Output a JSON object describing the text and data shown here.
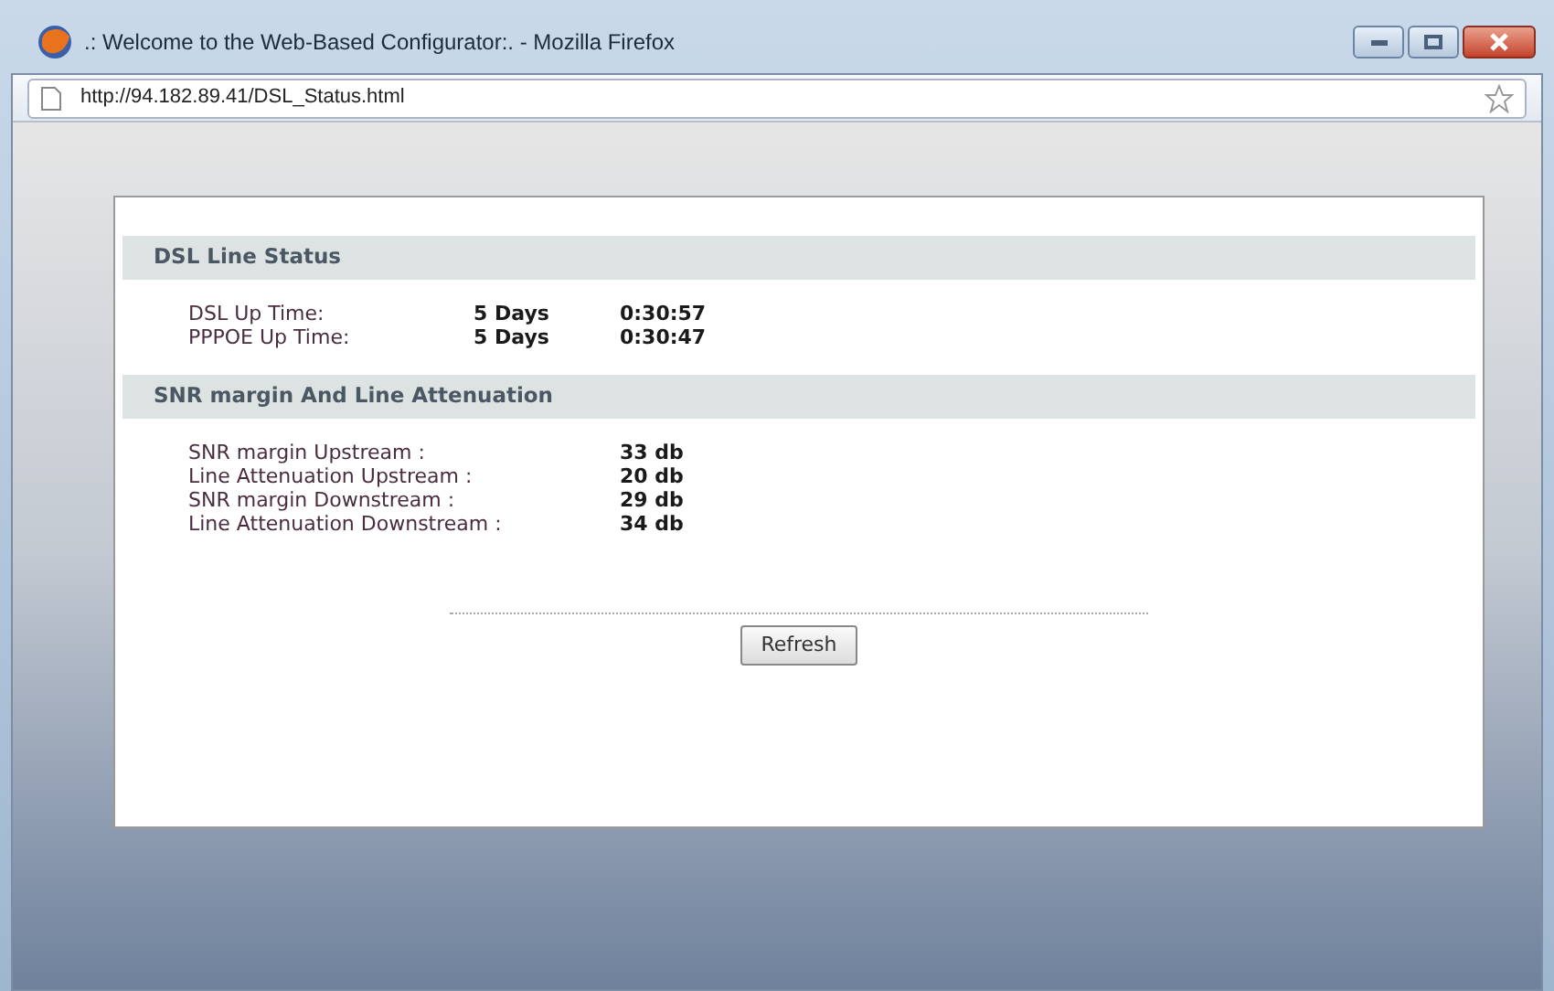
{
  "window": {
    "title": ".: Welcome to the Web-Based Configurator:. - Mozilla Firefox"
  },
  "address_bar": {
    "url": "http://94.182.89.41/DSL_Status.html"
  },
  "sections": [
    {
      "title": "DSL Line Status",
      "rows": [
        {
          "label": "DSL Up Time:",
          "values": [
            "5 Days",
            "0:30:57"
          ]
        },
        {
          "label": "PPPOE Up Time:",
          "values": [
            "5 Days",
            "0:30:47"
          ]
        }
      ]
    },
    {
      "title": "SNR margin And Line Attenuation",
      "rows": [
        {
          "label": "SNR margin Upstream :",
          "values": [
            "33 db"
          ]
        },
        {
          "label": "Line Attenuation Upstream :",
          "values": [
            "20 db"
          ]
        },
        {
          "label": "SNR margin Downstream :",
          "values": [
            "29 db"
          ]
        },
        {
          "label": "Line Attenuation Downstream :",
          "values": [
            "34 db"
          ]
        }
      ]
    }
  ],
  "buttons": [
    "Refresh"
  ]
}
